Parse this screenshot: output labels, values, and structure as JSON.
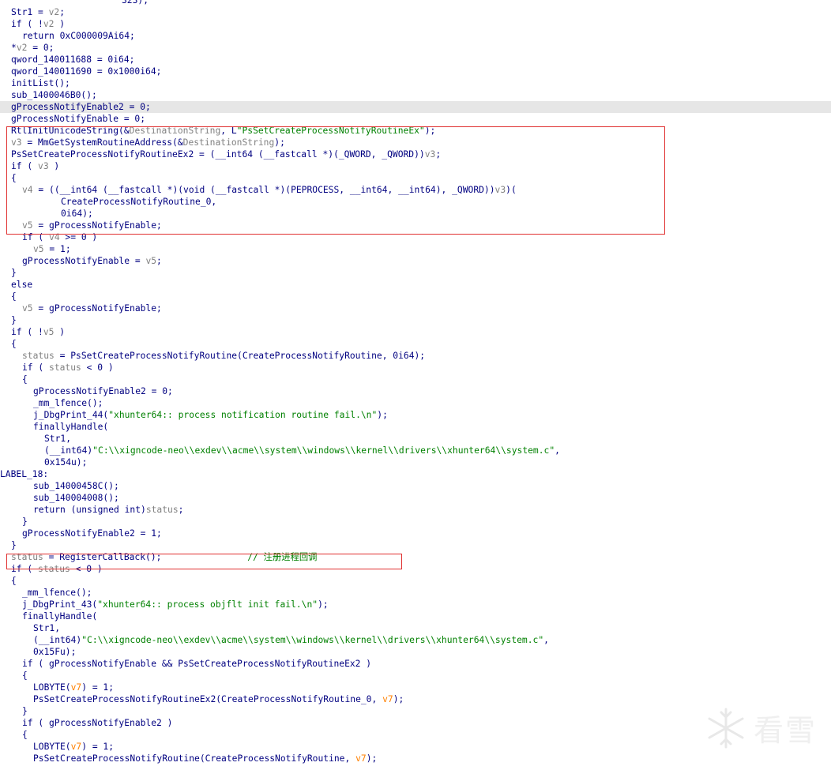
{
  "lines": [
    {
      "indent": 20,
      "tokens": [
        {
          "t": "323);"
        }
      ]
    },
    {
      "indent": 0,
      "tokens": [
        {
          "t": "Str1 = "
        },
        {
          "t": "v2",
          "c": "var"
        },
        {
          "t": ";"
        }
      ]
    },
    {
      "indent": 0,
      "tokens": [
        {
          "t": "if ( !"
        },
        {
          "t": "v2",
          "c": "var"
        },
        {
          "t": " )"
        }
      ]
    },
    {
      "indent": 2,
      "tokens": [
        {
          "t": "return 0xC000009Ai64;"
        }
      ]
    },
    {
      "indent": 0,
      "tokens": [
        {
          "t": "*"
        },
        {
          "t": "v2",
          "c": "var"
        },
        {
          "t": " = 0;"
        }
      ]
    },
    {
      "indent": 0,
      "tokens": [
        {
          "t": "qword_140011688 = 0i64;"
        }
      ]
    },
    {
      "indent": 0,
      "tokens": [
        {
          "t": "qword_140011690 = 0x1000i64;"
        }
      ]
    },
    {
      "indent": 0,
      "tokens": [
        {
          "t": "initList();"
        }
      ]
    },
    {
      "indent": 0,
      "tokens": [
        {
          "t": "sub_1400046B0();"
        }
      ]
    },
    {
      "indent": 0,
      "hl": true,
      "tokens": [
        {
          "t": "gProcessNotifyEnable2 = 0;"
        }
      ]
    },
    {
      "indent": 0,
      "tokens": [
        {
          "t": "gProcessNotifyEnable = 0;"
        }
      ]
    },
    {
      "indent": 0,
      "tokens": [
        {
          "t": "RtlInitUnicodeString(&"
        },
        {
          "t": "DestinationString",
          "c": "var"
        },
        {
          "t": ", L"
        },
        {
          "t": "\"PsSetCreateProcessNotifyRoutineEx\"",
          "c": "str"
        },
        {
          "t": ");"
        }
      ]
    },
    {
      "indent": 0,
      "tokens": [
        {
          "t": "v3",
          "c": "var"
        },
        {
          "t": " = MmGetSystemRoutineAddress(&"
        },
        {
          "t": "DestinationString",
          "c": "var"
        },
        {
          "t": ");"
        }
      ]
    },
    {
      "indent": 0,
      "tokens": [
        {
          "t": "PsSetCreateProcessNotifyRoutineEx2 = (__int64 (__fastcall *)(_QWORD, _QWORD))"
        },
        {
          "t": "v3",
          "c": "var"
        },
        {
          "t": ";"
        }
      ]
    },
    {
      "indent": 0,
      "tokens": [
        {
          "t": "if ( "
        },
        {
          "t": "v3",
          "c": "var"
        },
        {
          "t": " )"
        }
      ]
    },
    {
      "indent": 0,
      "tokens": [
        {
          "t": "{"
        }
      ]
    },
    {
      "indent": 2,
      "tokens": [
        {
          "t": "v4",
          "c": "var"
        },
        {
          "t": " = ((__int64 (__fastcall *)(void (__fastcall *)(PEPROCESS, __int64, __int64), _QWORD))"
        },
        {
          "t": "v3",
          "c": "var"
        },
        {
          "t": ")("
        }
      ]
    },
    {
      "indent": 9,
      "tokens": [
        {
          "t": "CreateProcessNotifyRoutine_0,"
        }
      ]
    },
    {
      "indent": 9,
      "tokens": [
        {
          "t": "0i64);"
        }
      ]
    },
    {
      "indent": 2,
      "tokens": [
        {
          "t": "v5",
          "c": "var"
        },
        {
          "t": " = gProcessNotifyEnable;"
        }
      ]
    },
    {
      "indent": 2,
      "tokens": [
        {
          "t": "if ( "
        },
        {
          "t": "v4",
          "c": "var"
        },
        {
          "t": " >= 0 )"
        }
      ]
    },
    {
      "indent": 4,
      "tokens": [
        {
          "t": "v5",
          "c": "var"
        },
        {
          "t": " = 1;"
        }
      ]
    },
    {
      "indent": 2,
      "tokens": [
        {
          "t": "gProcessNotifyEnable = "
        },
        {
          "t": "v5",
          "c": "var"
        },
        {
          "t": ";"
        }
      ]
    },
    {
      "indent": 0,
      "tokens": [
        {
          "t": "}"
        }
      ]
    },
    {
      "indent": 0,
      "tokens": [
        {
          "t": "else"
        }
      ]
    },
    {
      "indent": 0,
      "tokens": [
        {
          "t": "{"
        }
      ]
    },
    {
      "indent": 2,
      "tokens": [
        {
          "t": "v5",
          "c": "var"
        },
        {
          "t": " = gProcessNotifyEnable;"
        }
      ]
    },
    {
      "indent": 0,
      "tokens": [
        {
          "t": "}"
        }
      ]
    },
    {
      "indent": 0,
      "tokens": [
        {
          "t": "if ( !"
        },
        {
          "t": "v5",
          "c": "var"
        },
        {
          "t": " )"
        }
      ]
    },
    {
      "indent": 0,
      "tokens": [
        {
          "t": "{"
        }
      ]
    },
    {
      "indent": 2,
      "tokens": [
        {
          "t": "status",
          "c": "var"
        },
        {
          "t": " = PsSetCreateProcessNotifyRoutine(CreateProcessNotifyRoutine, 0i64);"
        }
      ]
    },
    {
      "indent": 2,
      "tokens": [
        {
          "t": "if ( "
        },
        {
          "t": "status",
          "c": "var"
        },
        {
          "t": " < 0 )"
        }
      ]
    },
    {
      "indent": 2,
      "tokens": [
        {
          "t": "{"
        }
      ]
    },
    {
      "indent": 4,
      "tokens": [
        {
          "t": "gProcessNotifyEnable2 = 0;"
        }
      ]
    },
    {
      "indent": 4,
      "tokens": [
        {
          "t": "_mm_lfence();"
        }
      ]
    },
    {
      "indent": 4,
      "tokens": [
        {
          "t": "j_DbgPrint_44("
        },
        {
          "t": "\"xhunter64:: process notification routine fail.\\n\"",
          "c": "str"
        },
        {
          "t": ");"
        }
      ]
    },
    {
      "indent": 4,
      "tokens": [
        {
          "t": "finallyHandle("
        }
      ]
    },
    {
      "indent": 6,
      "tokens": [
        {
          "t": "Str1,"
        }
      ]
    },
    {
      "indent": 6,
      "tokens": [
        {
          "t": "(__int64)"
        },
        {
          "t": "\"C:\\\\xigncode-neo\\\\exdev\\\\acme\\\\system\\\\windows\\\\kernel\\\\drivers\\\\xhunter64\\\\system.c\"",
          "c": "str"
        },
        {
          "t": ","
        }
      ]
    },
    {
      "indent": 6,
      "tokens": [
        {
          "t": "0x154u);"
        }
      ]
    },
    {
      "indent": -2,
      "tokens": [
        {
          "t": "LABEL_18:"
        }
      ]
    },
    {
      "indent": 4,
      "tokens": [
        {
          "t": "sub_14000458C();"
        }
      ]
    },
    {
      "indent": 4,
      "tokens": [
        {
          "t": "sub_140004008();"
        }
      ]
    },
    {
      "indent": 4,
      "tokens": [
        {
          "t": "return (unsigned int)"
        },
        {
          "t": "status",
          "c": "var"
        },
        {
          "t": ";"
        }
      ]
    },
    {
      "indent": 2,
      "tokens": [
        {
          "t": "}"
        }
      ]
    },
    {
      "indent": 2,
      "tokens": [
        {
          "t": "gProcessNotifyEnable2 = 1;"
        }
      ]
    },
    {
      "indent": 0,
      "tokens": [
        {
          "t": "}"
        }
      ]
    },
    {
      "indent": 0,
      "tokens": [
        {
          "t": "status",
          "c": "var"
        },
        {
          "t": " = RegisterCallBack();                "
        },
        {
          "t": "// 注册进程回调",
          "c": "cmt"
        }
      ]
    },
    {
      "indent": 0,
      "tokens": [
        {
          "t": "if ( "
        },
        {
          "t": "status",
          "c": "var"
        },
        {
          "t": " < 0 )"
        }
      ]
    },
    {
      "indent": 0,
      "tokens": [
        {
          "t": "{"
        }
      ]
    },
    {
      "indent": 2,
      "tokens": [
        {
          "t": "_mm_lfence();"
        }
      ]
    },
    {
      "indent": 2,
      "tokens": [
        {
          "t": "j_DbgPrint_43("
        },
        {
          "t": "\"xhunter64:: process objflt init fail.\\n\"",
          "c": "str"
        },
        {
          "t": ");"
        }
      ]
    },
    {
      "indent": 2,
      "tokens": [
        {
          "t": "finallyHandle("
        }
      ]
    },
    {
      "indent": 4,
      "tokens": [
        {
          "t": "Str1,"
        }
      ]
    },
    {
      "indent": 4,
      "tokens": [
        {
          "t": "(__int64)"
        },
        {
          "t": "\"C:\\\\xigncode-neo\\\\exdev\\\\acme\\\\system\\\\windows\\\\kernel\\\\drivers\\\\xhunter64\\\\system.c\"",
          "c": "str"
        },
        {
          "t": ","
        }
      ]
    },
    {
      "indent": 4,
      "tokens": [
        {
          "t": "0x15Fu);"
        }
      ]
    },
    {
      "indent": 2,
      "tokens": [
        {
          "t": "if ( gProcessNotifyEnable && PsSetCreateProcessNotifyRoutineEx2 )"
        }
      ]
    },
    {
      "indent": 2,
      "tokens": [
        {
          "t": "{"
        }
      ]
    },
    {
      "indent": 4,
      "tokens": [
        {
          "t": "LOBYTE("
        },
        {
          "t": "v7",
          "c": "lv"
        },
        {
          "t": ") = 1;"
        }
      ]
    },
    {
      "indent": 4,
      "tokens": [
        {
          "t": "PsSetCreateProcessNotifyRoutineEx2(CreateProcessNotifyRoutine_0, "
        },
        {
          "t": "v7",
          "c": "lv"
        },
        {
          "t": ");"
        }
      ]
    },
    {
      "indent": 2,
      "tokens": [
        {
          "t": "}"
        }
      ]
    },
    {
      "indent": 2,
      "tokens": [
        {
          "t": "if ( gProcessNotifyEnable2 )"
        }
      ]
    },
    {
      "indent": 2,
      "tokens": [
        {
          "t": "{"
        }
      ]
    },
    {
      "indent": 4,
      "tokens": [
        {
          "t": "LOBYTE("
        },
        {
          "t": "v7",
          "c": "lv"
        },
        {
          "t": ") = 1;"
        }
      ]
    },
    {
      "indent": 4,
      "tokens": [
        {
          "t": "PsSetCreateProcessNotifyRoutine(CreateProcessNotifyRoutine, "
        },
        {
          "t": "v7",
          "c": "lv"
        },
        {
          "t": ");"
        }
      ]
    }
  ],
  "watermark": {
    "text": "看雪",
    "icon": "snowflake-icon"
  }
}
